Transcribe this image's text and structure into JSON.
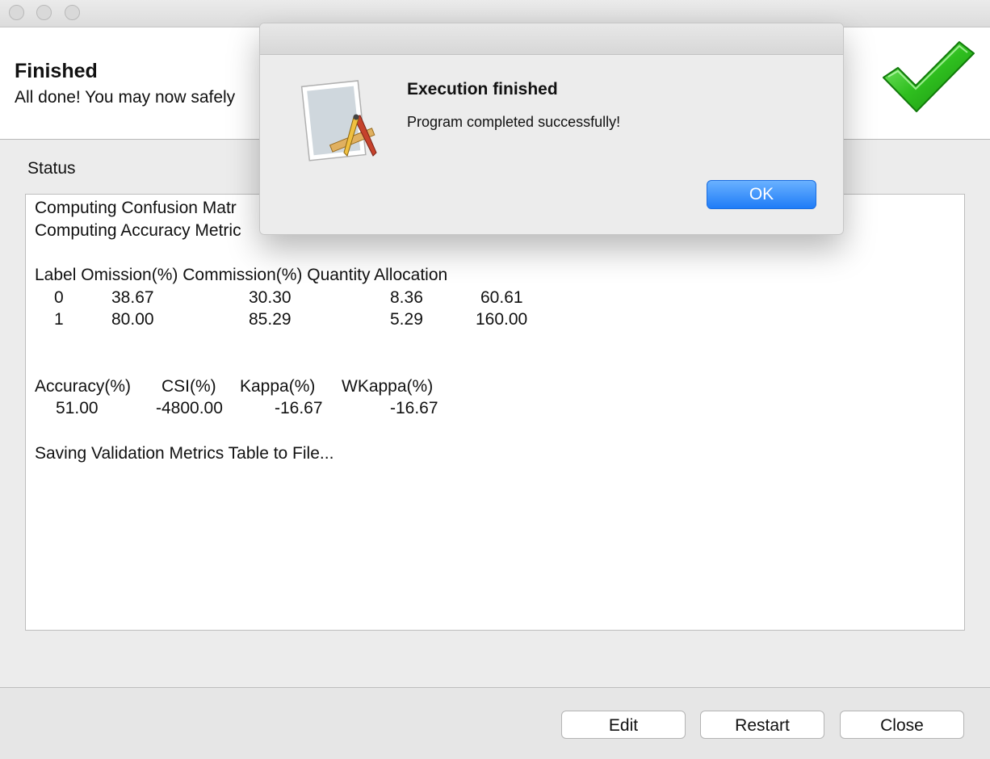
{
  "window": {
    "controls": [
      "close",
      "minimize",
      "zoom"
    ]
  },
  "header": {
    "title": "Finished",
    "subtitle": "All done! You may now safely",
    "status_icon": "green-checkmark-icon"
  },
  "status": {
    "label": "Status",
    "lines": [
      "Computing Confusion Matr",
      "Computing Accuracy Metric"
    ],
    "table1": {
      "header": "Label Omission(%) Commission(%) Quantity Allocation",
      "rows": [
        [
          "0",
          "38.67",
          "30.30",
          "8.36",
          "60.61"
        ],
        [
          "1",
          "80.00",
          "85.29",
          "5.29",
          "160.00"
        ]
      ]
    },
    "table2": {
      "headers": [
        "Accuracy(%)",
        "CSI(%)",
        "Kappa(%)",
        "WKappa(%)"
      ],
      "values": [
        "51.00",
        "-4800.00",
        "-16.67",
        "-16.67"
      ]
    },
    "final_line": "Saving Validation Metrics Table to File..."
  },
  "footer": {
    "buttons": {
      "edit": "Edit",
      "restart": "Restart",
      "close": "Close"
    }
  },
  "dialog": {
    "icon": "script-editor-app-icon",
    "title": "Execution finished",
    "message": "Program completed successfully!",
    "ok_label": "OK"
  },
  "colors": {
    "accent": "#1f7cf7",
    "check_green": "#2fbf1f",
    "window_bg": "#ececec"
  }
}
